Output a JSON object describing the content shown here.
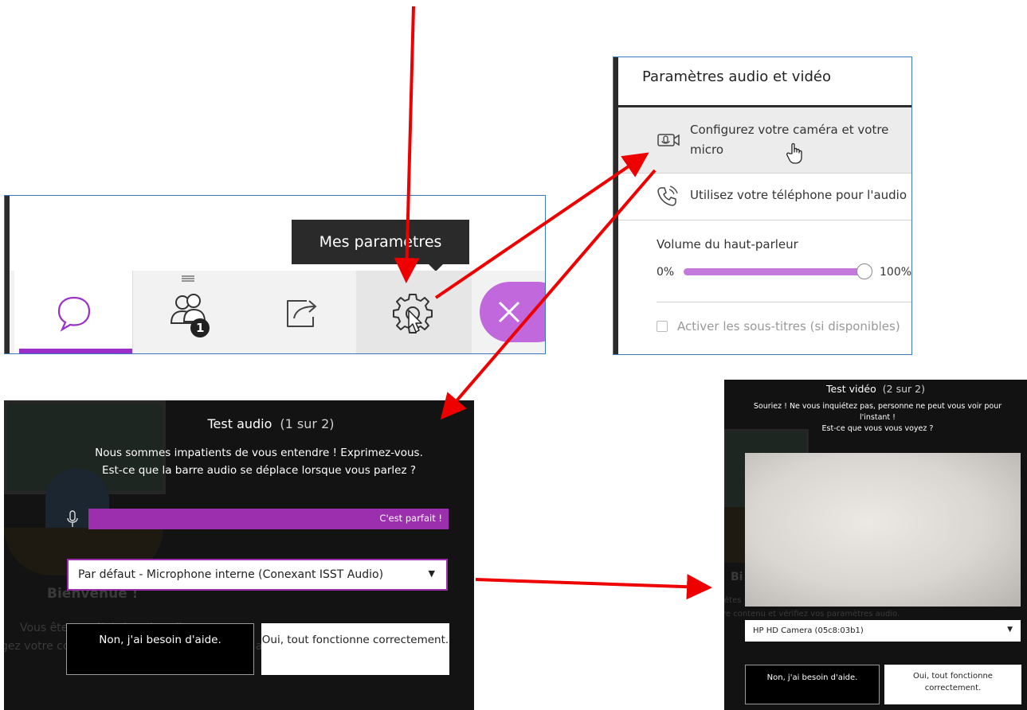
{
  "toolbar": {
    "tooltip": "Mes paramètres",
    "attendee_count": "1",
    "buttons": {
      "chat_icon": "chat-bubble-icon",
      "attendees_icon": "attendees-icon",
      "share_icon": "share-content-icon",
      "settings_icon": "gear-icon",
      "leave_icon": "close-icon"
    },
    "accent_color": "#9b30c8"
  },
  "settings_panel": {
    "title": "Paramètres audio et vidéo",
    "items": [
      {
        "label": "Configurez votre caméra et votre micro",
        "icon": "camera-mic-icon"
      },
      {
        "label": "Utilisez votre téléphone pour l'audio",
        "icon": "phone-icon"
      }
    ],
    "volume": {
      "label": "Volume du haut-parleur",
      "min_label": "0%",
      "max_label": "100%",
      "value_percent": 100
    },
    "subtitles_label": "Activer les sous-titres (si disponibles)",
    "subtitles_checked": false
  },
  "audio_test": {
    "title": "Test audio",
    "step": "(1 sur 2)",
    "description_line1": "Nous sommes impatients de vous entendre ! Exprimez-vous.",
    "description_line2": "Est-ce que la barre audio se déplace lorsque vous parlez ?",
    "meter_text": "C'est parfait !",
    "device": "Par défaut - Microphone interne (Conexant ISST Audio)",
    "help_button": "Non, j'ai besoin d'aide.",
    "ok_button": "Oui, tout fonctionne correctement.",
    "background_welcome": "Bienvenue !",
    "background_line1": "Vous êtes seul(e) dans la salle.",
    "background_line2": "gez votre contenu et vérifiez vos paramètres a"
  },
  "video_test": {
    "title": "Test vidéo",
    "step": "(2 sur 2)",
    "description_line1": "Souriez ! Ne vous inquiétez pas, personne ne peut vous voir pour l'instant !",
    "description_line2": "Est-ce que vous vous voyez ?",
    "device": "HP HD Camera (05c8:03b1)",
    "help_button": "Non, j'ai besoin d'aide.",
    "ok_button": "Oui, tout fonctionne correctement.",
    "background_bi": "Bi",
    "background_etes": "êtes",
    "background_line": "re contenu et vérifiez vos paramètres audio."
  },
  "annotation_color": "#ee0000"
}
